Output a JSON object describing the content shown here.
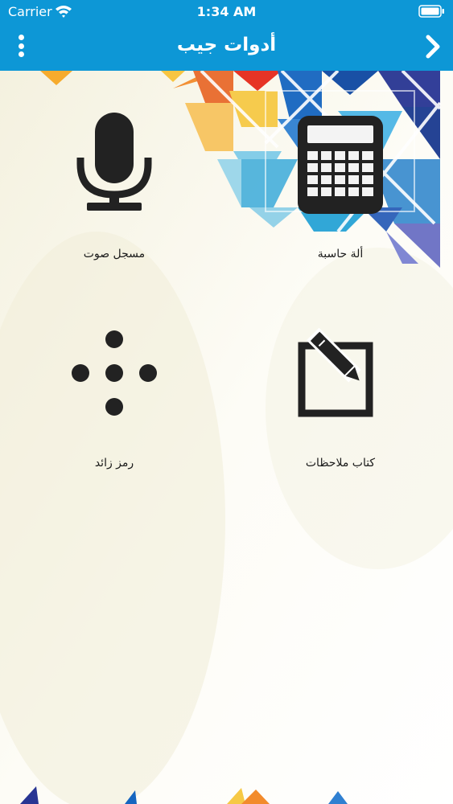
{
  "status_bar": {
    "carrier": "Carrier",
    "time": "1:34 AM"
  },
  "nav": {
    "title": "أدوات جيب",
    "background_color": "#0d97d6"
  },
  "tools": [
    {
      "label": "مسجل صوت",
      "icon": "microphone-icon"
    },
    {
      "label": "ألة حاسبة",
      "icon": "calculator-icon"
    },
    {
      "label": "رمز زائد",
      "icon": "plus-dots-icon"
    },
    {
      "label": "كتاب ملاحظات",
      "icon": "notebook-pencil-icon"
    }
  ]
}
